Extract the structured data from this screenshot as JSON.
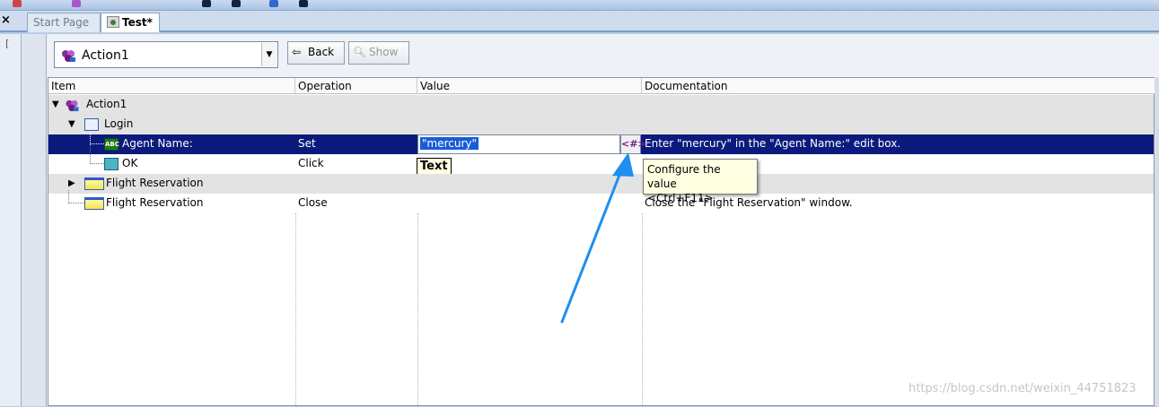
{
  "tabs": [
    {
      "label": "Start Page"
    },
    {
      "label": "Test*"
    }
  ],
  "close_glyph": "×",
  "gutter_bracket": "[",
  "action_combo": {
    "value": "Action1"
  },
  "toolbar": {
    "back_label": "Back",
    "show_label": "Show"
  },
  "grid": {
    "columns": [
      "Item",
      "Operation",
      "Value",
      "Documentation"
    ],
    "rows": [
      {
        "item": "Action1",
        "operation": "",
        "value": "",
        "documentation": ""
      },
      {
        "item": "Login",
        "operation": "",
        "value": "",
        "documentation": ""
      },
      {
        "item": "Agent Name:",
        "operation": "Set",
        "value": "\"mercury\"",
        "documentation": "Enter \"mercury\" in the \"Agent Name:\" edit box."
      },
      {
        "item": "OK",
        "operation": "Click",
        "value": "Text",
        "documentation": ""
      },
      {
        "item": "Flight Reservation",
        "operation": "",
        "value": "",
        "documentation": ""
      },
      {
        "item": "Flight Reservation",
        "operation": "Close",
        "value": "",
        "documentation": "Close the \"Flight Reservation\" window."
      }
    ]
  },
  "configure_btn_glyph": "<#>",
  "tooltip": {
    "line1": "Configure the value",
    "line2": "<Ctrl+F11>"
  },
  "abc_icon_text": "ABC",
  "watermark": "https://blog.csdn.net/weixin_44751823",
  "colors": {
    "selection": "#0b1a7d",
    "arrow": "#1e8ff0"
  }
}
